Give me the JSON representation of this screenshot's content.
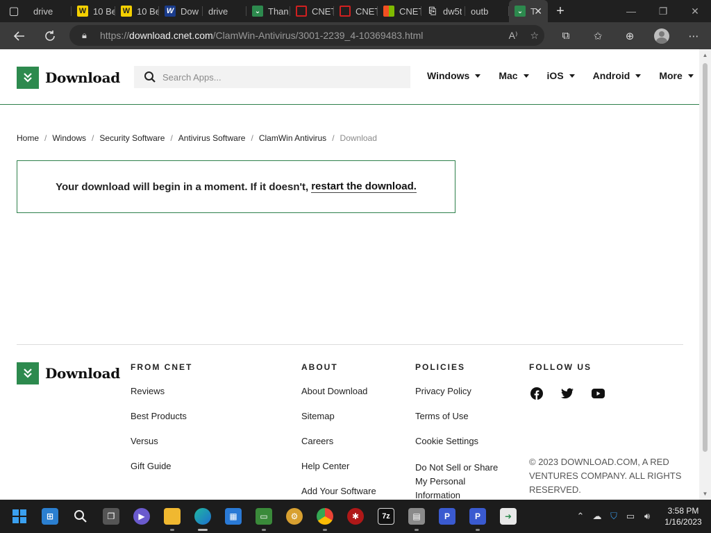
{
  "browser": {
    "tabs": [
      {
        "icon": "search",
        "label": "drive"
      },
      {
        "icon": "wy",
        "label": "10 Be"
      },
      {
        "icon": "wy",
        "label": "10 Be"
      },
      {
        "icon": "ww",
        "label": "Dow"
      },
      {
        "icon": "search",
        "label": "drive"
      },
      {
        "icon": "dl",
        "label": "Than"
      },
      {
        "icon": "cn",
        "label": "CNET"
      },
      {
        "icon": "cn",
        "label": "CNET"
      },
      {
        "icon": "ms",
        "label": "CNET"
      },
      {
        "icon": "doc",
        "label": "dw5t"
      },
      {
        "icon": "search",
        "label": "outb"
      },
      {
        "icon": "dl",
        "label": "T",
        "active": true
      }
    ],
    "address": {
      "prefix": "https://",
      "host": "download.cnet.com",
      "path": "/ClamWin-Antivirus/3001-2239_4-10369483.html"
    }
  },
  "header": {
    "logo_text": "Download",
    "search_placeholder": "Search Apps...",
    "nav": [
      "Windows",
      "Mac",
      "iOS",
      "Android",
      "More"
    ]
  },
  "breadcrumb": [
    "Home",
    "Windows",
    "Security Software",
    "Antivirus Software",
    "ClamWin Antivirus",
    "Download"
  ],
  "notice": {
    "text": "Your download will begin in a moment. If it doesn't,",
    "link": "restart the download."
  },
  "footer": {
    "logo_text": "Download",
    "from_cnet": {
      "title": "FROM CNET",
      "links": [
        "Reviews",
        "Best Products",
        "Versus",
        "Gift Guide"
      ]
    },
    "about": {
      "title": "ABOUT",
      "links": [
        "About Download",
        "Sitemap",
        "Careers",
        "Help Center",
        "Add Your Software"
      ]
    },
    "policies": {
      "title": "POLICIES",
      "links": [
        "Privacy Policy",
        "Terms of Use",
        "Cookie Settings",
        "Do Not Sell or Share My Personal Information"
      ]
    },
    "follow": {
      "title": "FOLLOW US",
      "social": [
        "facebook-icon",
        "twitter-icon",
        "youtube-icon"
      ]
    },
    "copyright": "© 2023 DOWNLOAD.COM, A RED VENTURES COMPANY. ALL RIGHTS RESERVED."
  },
  "taskbar": {
    "time": "3:58 PM",
    "date": "1/16/2023"
  },
  "colors": {
    "brand_green": "#2d8a4e",
    "border_green": "#2d7f4a"
  }
}
